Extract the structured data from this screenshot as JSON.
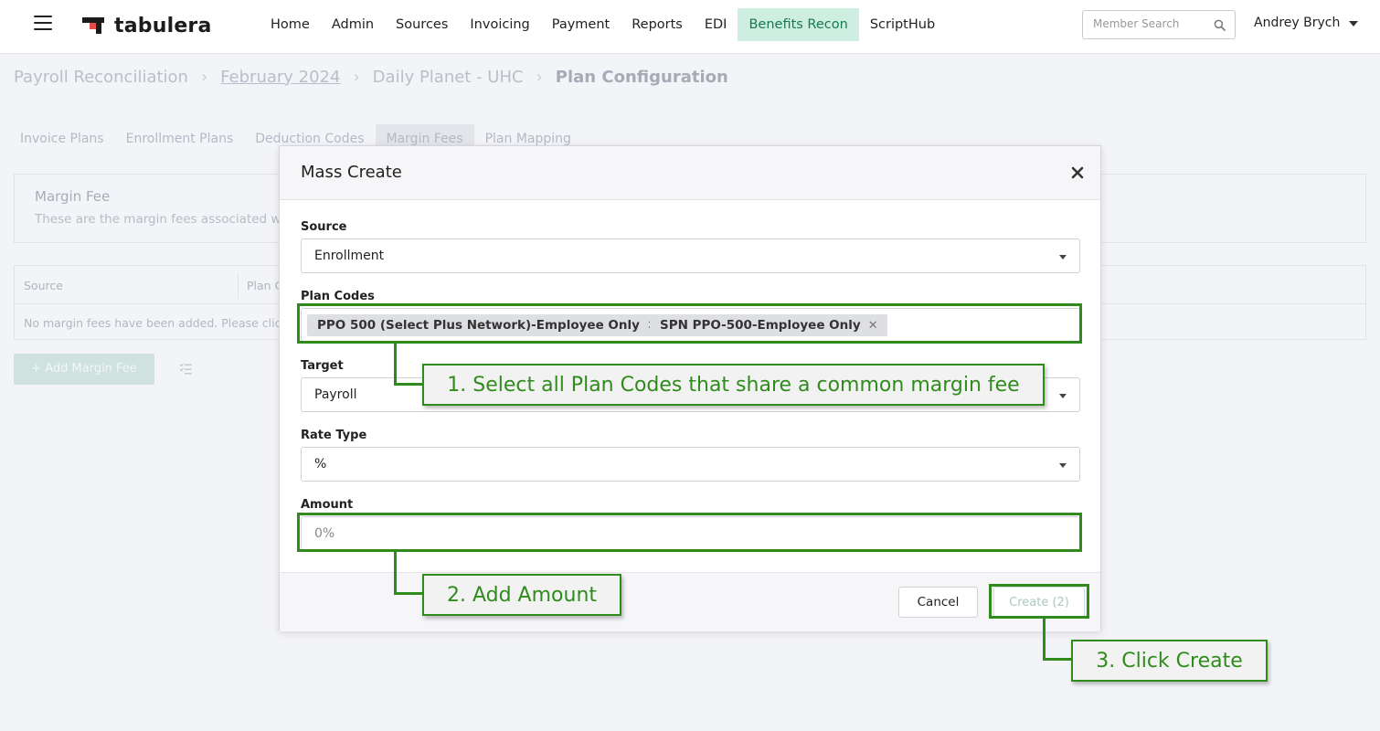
{
  "app": {
    "logo_text": "tabulera"
  },
  "nav": {
    "items": [
      "Home",
      "Admin",
      "Sources",
      "Invoicing",
      "Payment",
      "Reports",
      "EDI",
      "Benefits Recon",
      "ScriptHub"
    ],
    "active": "Benefits Recon",
    "active_color": "#cdeee0"
  },
  "search": {
    "placeholder": "Member Search"
  },
  "user": {
    "name": "Andrey Brych"
  },
  "breadcrumb": {
    "items": [
      "Payroll Reconciliation",
      "February 2024",
      "Daily Planet - UHC",
      "Plan Configuration"
    ]
  },
  "tabs": {
    "items": [
      "Invoice Plans",
      "Enrollment Plans",
      "Deduction Codes",
      "Margin Fees",
      "Plan Mapping"
    ],
    "active": "Margin Fees"
  },
  "card": {
    "title": "Margin Fee",
    "subtitle": "These are the margin fees associated w"
  },
  "table": {
    "headers": [
      "Source",
      "Plan C"
    ],
    "empty_text": "No margin fees have been added. Please clic"
  },
  "add_button": {
    "label": "+ Add Margin Fee"
  },
  "modal": {
    "title": "Mass Create",
    "source": {
      "label": "Source",
      "value": "Enrollment"
    },
    "plan_codes": {
      "label": "Plan Codes",
      "tags": [
        "PPO 500 (Select Plus Network)-Employee Only",
        "SPN PPO-500-Employee Only"
      ],
      "remove_glyph": "✕"
    },
    "target": {
      "label": "Target",
      "value": "Payroll"
    },
    "rate_type": {
      "label": "Rate Type",
      "value": "%"
    },
    "amount": {
      "label": "Amount",
      "placeholder": "0%"
    },
    "cancel_label": "Cancel",
    "create_label": "Create (2)"
  },
  "annotations": {
    "color": "#2f8c1c",
    "step1": "1. Select all Plan Codes that share a common margin fee",
    "step2": "2. Add Amount",
    "step3": "3. Click Create"
  }
}
